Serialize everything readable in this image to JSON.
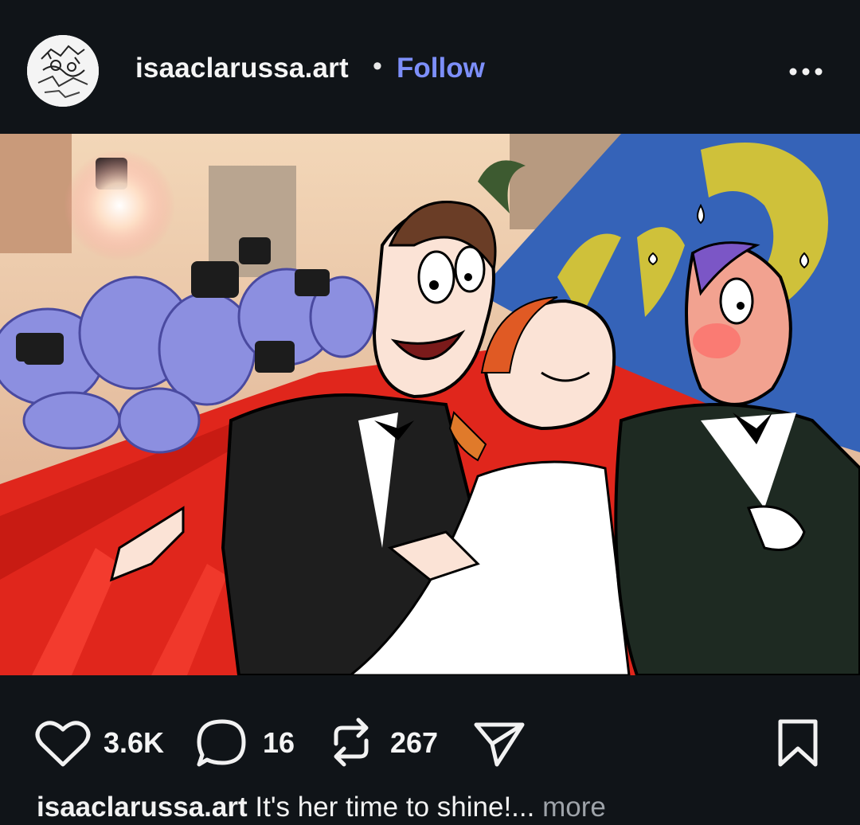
{
  "post": {
    "author": "isaaclarussa.art",
    "separator": "•",
    "follow_label": "Follow",
    "more_icon": "more-horizontal-icon",
    "image_alt": "Cartoon illustration: a grinning man in a tuxedo and a woman in a white gown walk arm-in-arm with a nervous bald man on a red carpet, while a crowd of photographers with flashing cameras chase them."
  },
  "actions": {
    "likes": "3.6K",
    "comments": "16",
    "reposts": "267",
    "like_icon": "heart-icon",
    "comment_icon": "comment-bubble-icon",
    "repost_icon": "repost-icon",
    "share_icon": "send-icon",
    "save_icon": "bookmark-icon"
  },
  "caption": {
    "user": "isaaclarussa.art",
    "text": " It's her time to shine!...",
    "more": " more"
  },
  "colors": {
    "background": "#101418",
    "follow": "#7d8ffa",
    "muted": "#9ea3a9"
  }
}
